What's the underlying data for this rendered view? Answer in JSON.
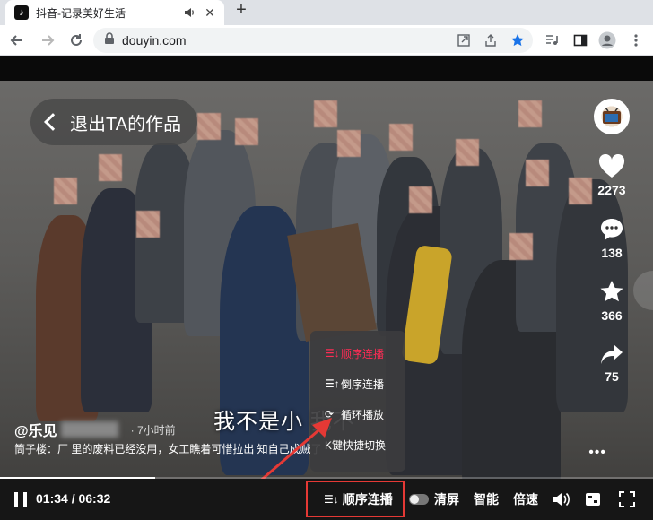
{
  "browser": {
    "tab_title": "抖音-记录美好生活",
    "favicon_glyph": "♪",
    "close_glyph": "✕",
    "new_tab_glyph": "+",
    "url": "douyin.com"
  },
  "video": {
    "exit_label": "退出TA的作品",
    "likes": "2273",
    "comments": "138",
    "favorites": "366",
    "shares": "75",
    "subtitle": "我不是小        我不",
    "author": "@乐见",
    "time_ago": "· 7小时前",
    "description": "筒子楼：厂 里的废料已经没用，女工瞧着可惜拉出          知自己成贼了",
    "more": "•••",
    "progress": 0.2375
  },
  "playback_menu": {
    "items": [
      {
        "icon": "☰↓",
        "label": "顺序连播",
        "active": true
      },
      {
        "icon": "☰↑",
        "label": "倒序连播",
        "active": false
      },
      {
        "icon": "⟳",
        "label": "循环播放",
        "active": false
      },
      {
        "icon": "",
        "label": "K键快捷切换",
        "active": false
      }
    ]
  },
  "controls": {
    "time": "01:34 / 06:32",
    "order_icon": "☰↓",
    "order_label": "顺序连播",
    "clear_screen": "清屏",
    "smart": "智能",
    "speed": "倍速"
  },
  "colors": {
    "accent": "#fe2c55",
    "highlight_box": "#e53935",
    "arrow": "#e53935"
  }
}
